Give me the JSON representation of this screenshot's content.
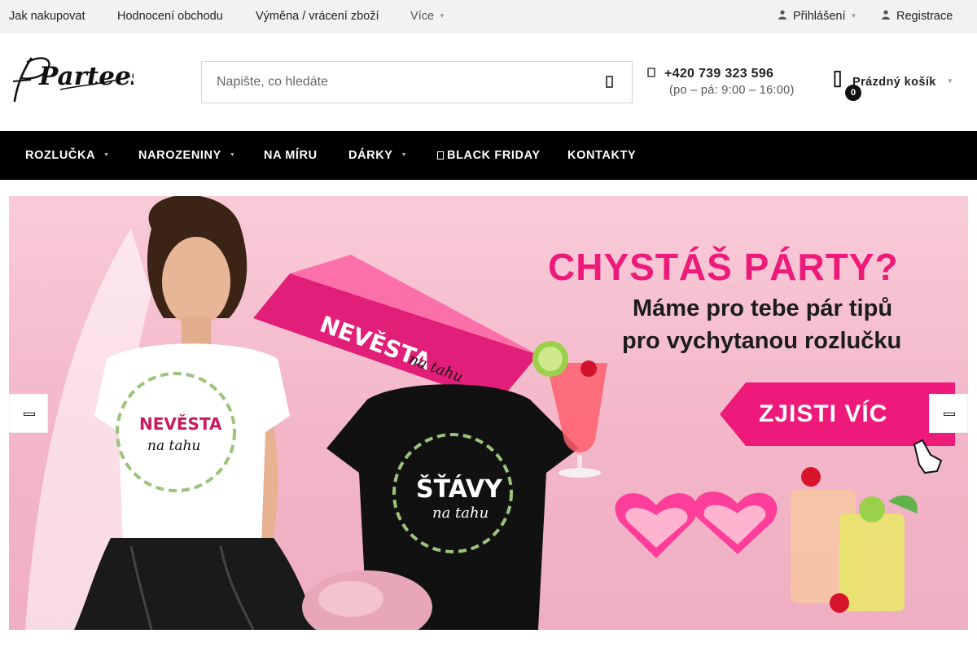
{
  "topbar": {
    "links": [
      "Jak nakupovat",
      "Hodnocení obchodu",
      "Výměna / vrácení zboží"
    ],
    "more": "Více",
    "login": "Přihlášení",
    "register": "Registrace"
  },
  "header": {
    "logo_text": "Partees",
    "search_placeholder": "Napište, co hledáte",
    "phone": "+420 739 323 596",
    "hours": "(po – pá: 9:00 – 16:00)",
    "cart_label": "Prázdný košík",
    "cart_count": "0"
  },
  "nav": {
    "items": [
      "ROZLUČKA",
      "NAROZENINY",
      "NA MÍRU",
      "DÁRKY",
      "BLACK FRIDAY",
      "KONTAKTY"
    ]
  },
  "banner": {
    "headline": "CHYSTÁŠ PÁRTY?",
    "line1": "Máme pro tebe pár tipů",
    "line2": "pro vychytanou rozlučku",
    "cta": "ZJISTI VÍC",
    "sash_text": "NEVĚSTA",
    "sash_script": "na tahu",
    "white_tee_text": "NEVĚSTA",
    "white_tee_script": "na tahu",
    "black_tee_text": "ŠŤÁVY",
    "black_tee_script": "na tahu"
  },
  "colors": {
    "accent_pink": "#ee1a7a",
    "nav_bg": "#000000",
    "topbar_bg": "#f2f2f2",
    "banner_bg": "#f3b6c9"
  }
}
